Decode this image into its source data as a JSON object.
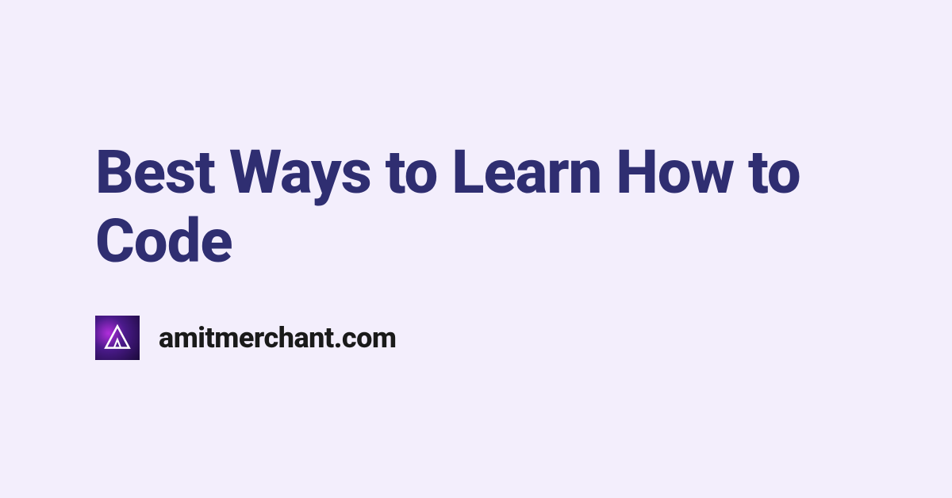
{
  "title": "Best Ways to Learn How to Code",
  "site_name": "amitmerchant.com",
  "colors": {
    "background": "#f3eefc",
    "title": "#2f2e71",
    "site_name": "#1a1a1a"
  }
}
